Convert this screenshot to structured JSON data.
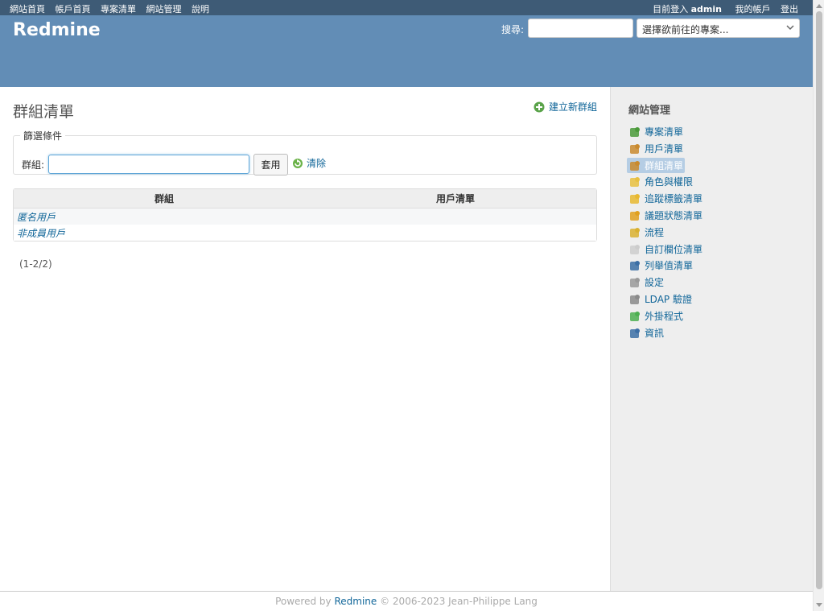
{
  "top_menu": {
    "left": [
      "網站首頁",
      "帳戶首頁",
      "專案清單",
      "網站管理",
      "說明"
    ],
    "logged_in_prefix": "目前登入",
    "username": "admin",
    "my_account": "我的帳戶",
    "logout": "登出"
  },
  "header": {
    "title": "Redmine",
    "search_label": "搜尋:",
    "search_value": "",
    "project_jump": "選擇欲前往的專案..."
  },
  "content": {
    "title": "群組清單",
    "new_group": "建立新群組",
    "filters_legend": "篩選條件",
    "group_label": "群組:",
    "group_value": "",
    "apply": "套用",
    "clear": "清除",
    "table": {
      "columns": [
        "群組",
        "用戶清單"
      ],
      "rows": [
        {
          "name": "匿名用戶",
          "users": ""
        },
        {
          "name": "非成員用戶",
          "users": ""
        }
      ]
    },
    "pagination": "(1-2/2)"
  },
  "sidebar": {
    "title": "網站管理",
    "items": [
      {
        "label": "專案清單",
        "icon": "projects-icon",
        "color": "#4a9a3a"
      },
      {
        "label": "用戶清單",
        "icon": "user-icon",
        "color": "#c98a2e"
      },
      {
        "label": "群組清單",
        "icon": "group-icon",
        "color": "#c98a2e",
        "selected": true
      },
      {
        "label": "角色與權限",
        "icon": "roles-icon",
        "color": "#e8c040"
      },
      {
        "label": "追蹤標籤清單",
        "icon": "tracker-icon",
        "color": "#e8b830"
      },
      {
        "label": "議題狀態清單",
        "icon": "issue-status-icon",
        "color": "#e0a020"
      },
      {
        "label": "流程",
        "icon": "workflow-icon",
        "color": "#d9b030"
      },
      {
        "label": "自訂欄位清單",
        "icon": "custom-fields-icon",
        "color": "#cccccc"
      },
      {
        "label": "列舉值清單",
        "icon": "enumerations-icon",
        "color": "#3b6ea5"
      },
      {
        "label": "設定",
        "icon": "settings-gear-icon",
        "color": "#999999"
      },
      {
        "label": "LDAP 驗證",
        "icon": "ldap-icon",
        "color": "#8a8a8a"
      },
      {
        "label": "外掛程式",
        "icon": "plugin-icon",
        "color": "#4caf50"
      },
      {
        "label": "資訊",
        "icon": "info-icon",
        "color": "#3b6ea5"
      }
    ]
  },
  "footer": {
    "prefix": "Powered by",
    "link": "Redmine",
    "suffix": "© 2006-2023 Jean-Philippe Lang"
  },
  "colors": {
    "top_menu_bg": "#3e5b76",
    "header_bg": "#628db6",
    "link": "#169",
    "sidebar_bg": "#eeeeee"
  }
}
